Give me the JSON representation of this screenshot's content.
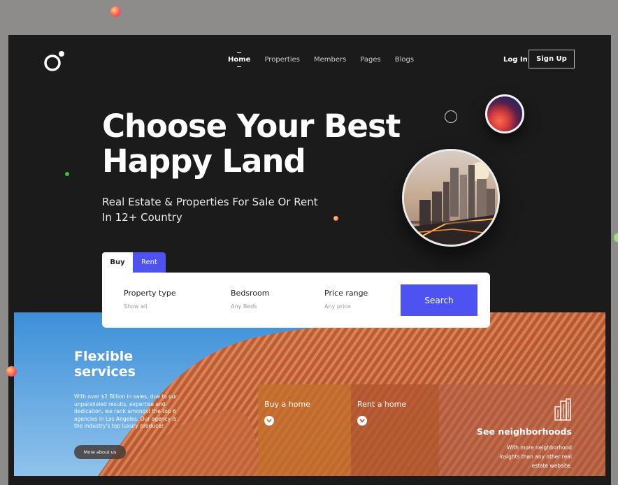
{
  "nav": {
    "items": [
      {
        "label": "Home",
        "active": true
      },
      {
        "label": "Properties",
        "active": false
      },
      {
        "label": "Members",
        "active": false
      },
      {
        "label": "Pages",
        "active": false
      },
      {
        "label": "Blogs",
        "active": false
      }
    ],
    "login_label": "Log In",
    "signup_label": "Sign Up"
  },
  "hero": {
    "title_line1": "Choose Your Best",
    "title_line2": "Happy Land",
    "subtitle_line1": "Real Estate & Properties For Sale Or Rent",
    "subtitle_line2": "In 12+ Country"
  },
  "search": {
    "tabs": {
      "buy": "Buy",
      "rent": "Rent"
    },
    "property_type": {
      "label": "Property type",
      "value": "Show all"
    },
    "bedrooms": {
      "label": "Bedsroom",
      "value": "Any Beds"
    },
    "price_range": {
      "label": "Price range",
      "value": "Any price"
    },
    "button_label": "Search"
  },
  "services": {
    "title_line1": "Flexible",
    "title_line2": "services",
    "description": "With over $2 Billion in sales, due to our unparalleled results, expertise and dedication, we rank amongst the top 6 agencies in Los Angeles. Our agency is the industry's top luxury producer.",
    "more_label": "More about us"
  },
  "cards": {
    "buy": {
      "title": "Buy a home"
    },
    "rent": {
      "title": "Rent a home"
    },
    "neighborhoods": {
      "title": "See neighborhoods",
      "text": "With more neighborhood insights than any other real estate website."
    }
  },
  "colors": {
    "accent": "#4e52f0",
    "background": "#1b1b1b",
    "page_bg": "#8e8c8b"
  }
}
